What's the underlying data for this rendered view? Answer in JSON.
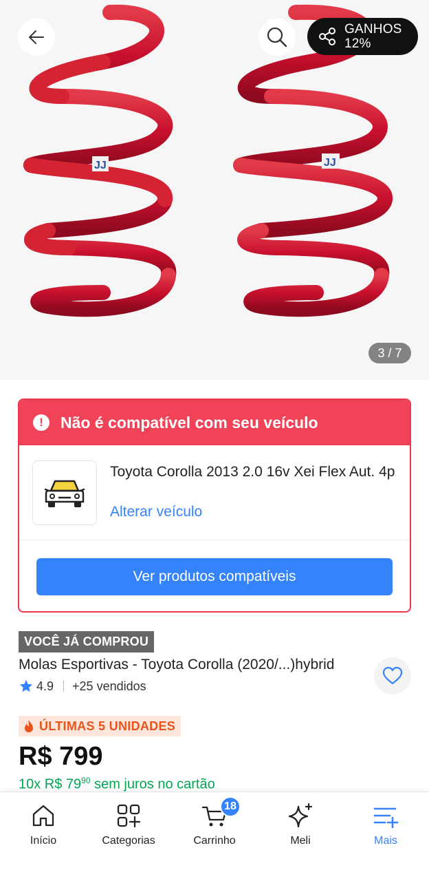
{
  "gallery": {
    "image_alt": "Molas Esportivas - Toyota Corolla",
    "earnings_label": "GANHOS",
    "earnings_value": "12%",
    "counter": "3 / 7"
  },
  "compatibility": {
    "title": "Não é compatível com seu veículo",
    "warning_symbol": "!",
    "vehicle_name": "Toyota Corolla 2013 2.0 16v Xei Flex Aut. 4p",
    "change_vehicle": "Alterar veículo",
    "cta": "Ver produtos compatíveis"
  },
  "product": {
    "badge": "VOCÊ JÁ COMPROU",
    "title": "Molas Esportivas - Toyota Corolla (2020/...)hybrid",
    "rating": "4.9",
    "sold": "+25 vendidos",
    "stock_badge": "ÚLTIMAS 5 UNIDADES",
    "price": "R$ 799",
    "installments_prefix": "10x R$ 79",
    "installments_cents": "90",
    "installments_suffix": " sem juros no cartão"
  },
  "bottom_nav": {
    "items": [
      {
        "label": "Início",
        "icon": "home-icon"
      },
      {
        "label": "Categorias",
        "icon": "categories-icon"
      },
      {
        "label": "Carrinho",
        "icon": "cart-icon",
        "badge": "18"
      },
      {
        "label": "Meli",
        "icon": "sparkle-icon"
      },
      {
        "label": "Mais",
        "icon": "menu-plus-icon",
        "active": true
      }
    ]
  },
  "colors": {
    "brand_blue": "#3483fa",
    "alert_red": "#f04358",
    "spring_red": "#c8102e",
    "install_green": "#00a650",
    "stock_orange": "#e8541b"
  }
}
